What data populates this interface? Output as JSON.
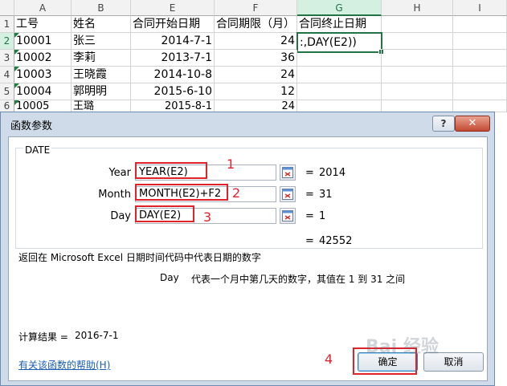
{
  "sheet": {
    "columns": [
      "",
      "A",
      "B",
      "E",
      "F",
      "G",
      "H",
      "I"
    ],
    "rows": [
      {
        "num": "1",
        "cells": [
          "工号",
          "姓名",
          "合同开始日期",
          "合同期限（月）",
          "合同终止日期"
        ]
      },
      {
        "num": "2",
        "cells": [
          "10001",
          "张三",
          "2014-7-1",
          "24",
          ":,DAY(E2))"
        ]
      },
      {
        "num": "3",
        "cells": [
          "10002",
          "李莉",
          "2013-7-1",
          "36",
          ""
        ]
      },
      {
        "num": "4",
        "cells": [
          "10003",
          "王晓霞",
          "2014-10-8",
          "24",
          ""
        ]
      },
      {
        "num": "5",
        "cells": [
          "10004",
          "郭明明",
          "2015-6-10",
          "12",
          ""
        ]
      },
      {
        "num": "6",
        "cells": [
          "10005",
          "王璐",
          "2015-8-1",
          "24",
          ""
        ]
      }
    ]
  },
  "dialog": {
    "title": "函数参数",
    "help_label": "?",
    "close_label": "✕",
    "function_name": "DATE",
    "args": [
      {
        "label": "Year",
        "value": "YEAR(E2)",
        "result": "2014"
      },
      {
        "label": "Month",
        "value": "MONTH(E2)+F2",
        "result": "31"
      },
      {
        "label": "Day",
        "value": "DAY(E2)",
        "result": "1"
      }
    ],
    "equals": "=",
    "formula_result": "42552",
    "description": "返回在 Microsoft Excel 日期时间代码中代表日期的数字",
    "arg_help_name": "Day",
    "arg_help_text": "代表一个月中第几天的数字，其值在 1 到 31 之间",
    "calc_result_label": "计算结果 =",
    "calc_result_value": "2016-7-1",
    "help_link": "有关该函数的帮助(H)",
    "ok_label": "确定",
    "cancel_label": "取消"
  },
  "annotations": [
    "1",
    "2",
    "3",
    "4"
  ],
  "watermark": "Bai 经验",
  "colors": {
    "annotation": "#e0232b",
    "excel_green": "#217346"
  }
}
